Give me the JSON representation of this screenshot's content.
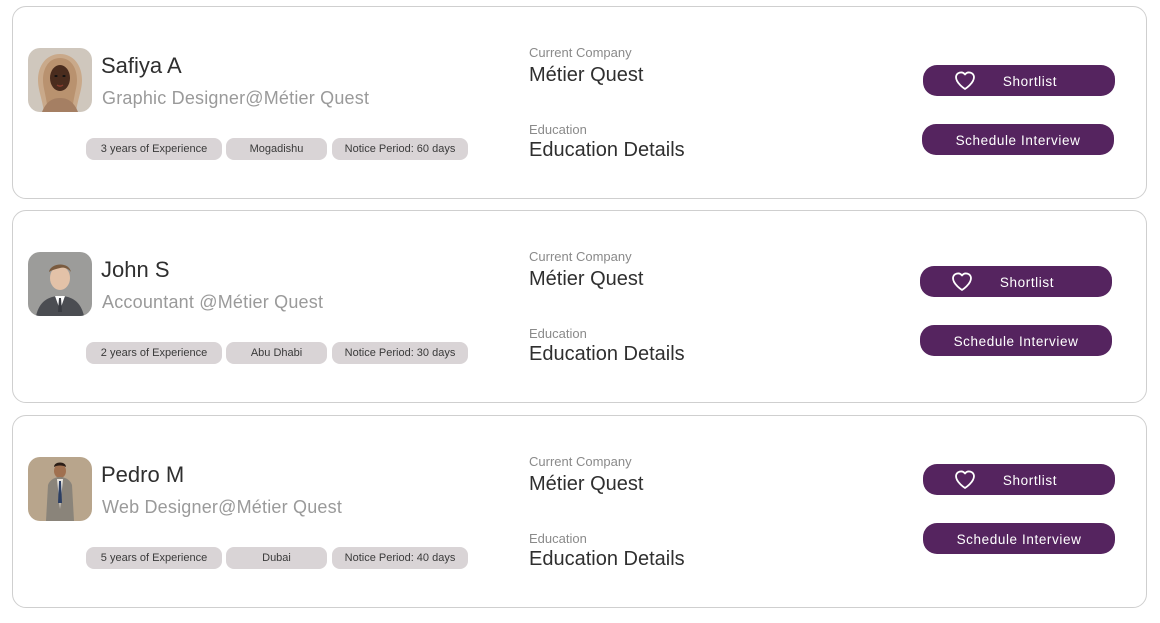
{
  "candidates": [
    {
      "name": "Safiya A",
      "role": "Graphic Designer@Métier Quest",
      "tags": [
        "3 years of Experience",
        "Mogadishu",
        "Notice Period: 60 days"
      ],
      "company_label": "Current Company",
      "company": "Métier Quest",
      "education_label": "Education",
      "education": "Education Details",
      "shortlist_label": "Shortlist",
      "schedule_label": "Schedule Interview"
    },
    {
      "name": "John S",
      "role": "Accountant @Métier Quest",
      "tags": [
        "2 years of Experience",
        "Abu Dhabi",
        "Notice Period: 30 days"
      ],
      "company_label": "Current Company",
      "company": "Métier Quest",
      "education_label": "Education",
      "education": "Education Details",
      "shortlist_label": "Shortlist",
      "schedule_label": "Schedule Interview"
    },
    {
      "name": "Pedro M",
      "role": "Web Designer@Métier Quest",
      "tags": [
        "5 years of Experience",
        "Dubai",
        "Notice Period: 40 days"
      ],
      "company_label": "Current Company",
      "company": "Métier Quest",
      "education_label": "Education",
      "education": "Education Details",
      "shortlist_label": "Shortlist",
      "schedule_label": "Schedule Interview"
    }
  ],
  "colors": {
    "accent": "#55245f",
    "tag_bg": "#d9d4d6",
    "border": "#cfcfcf"
  },
  "icons": {
    "shortlist": "heart-outline-icon"
  }
}
